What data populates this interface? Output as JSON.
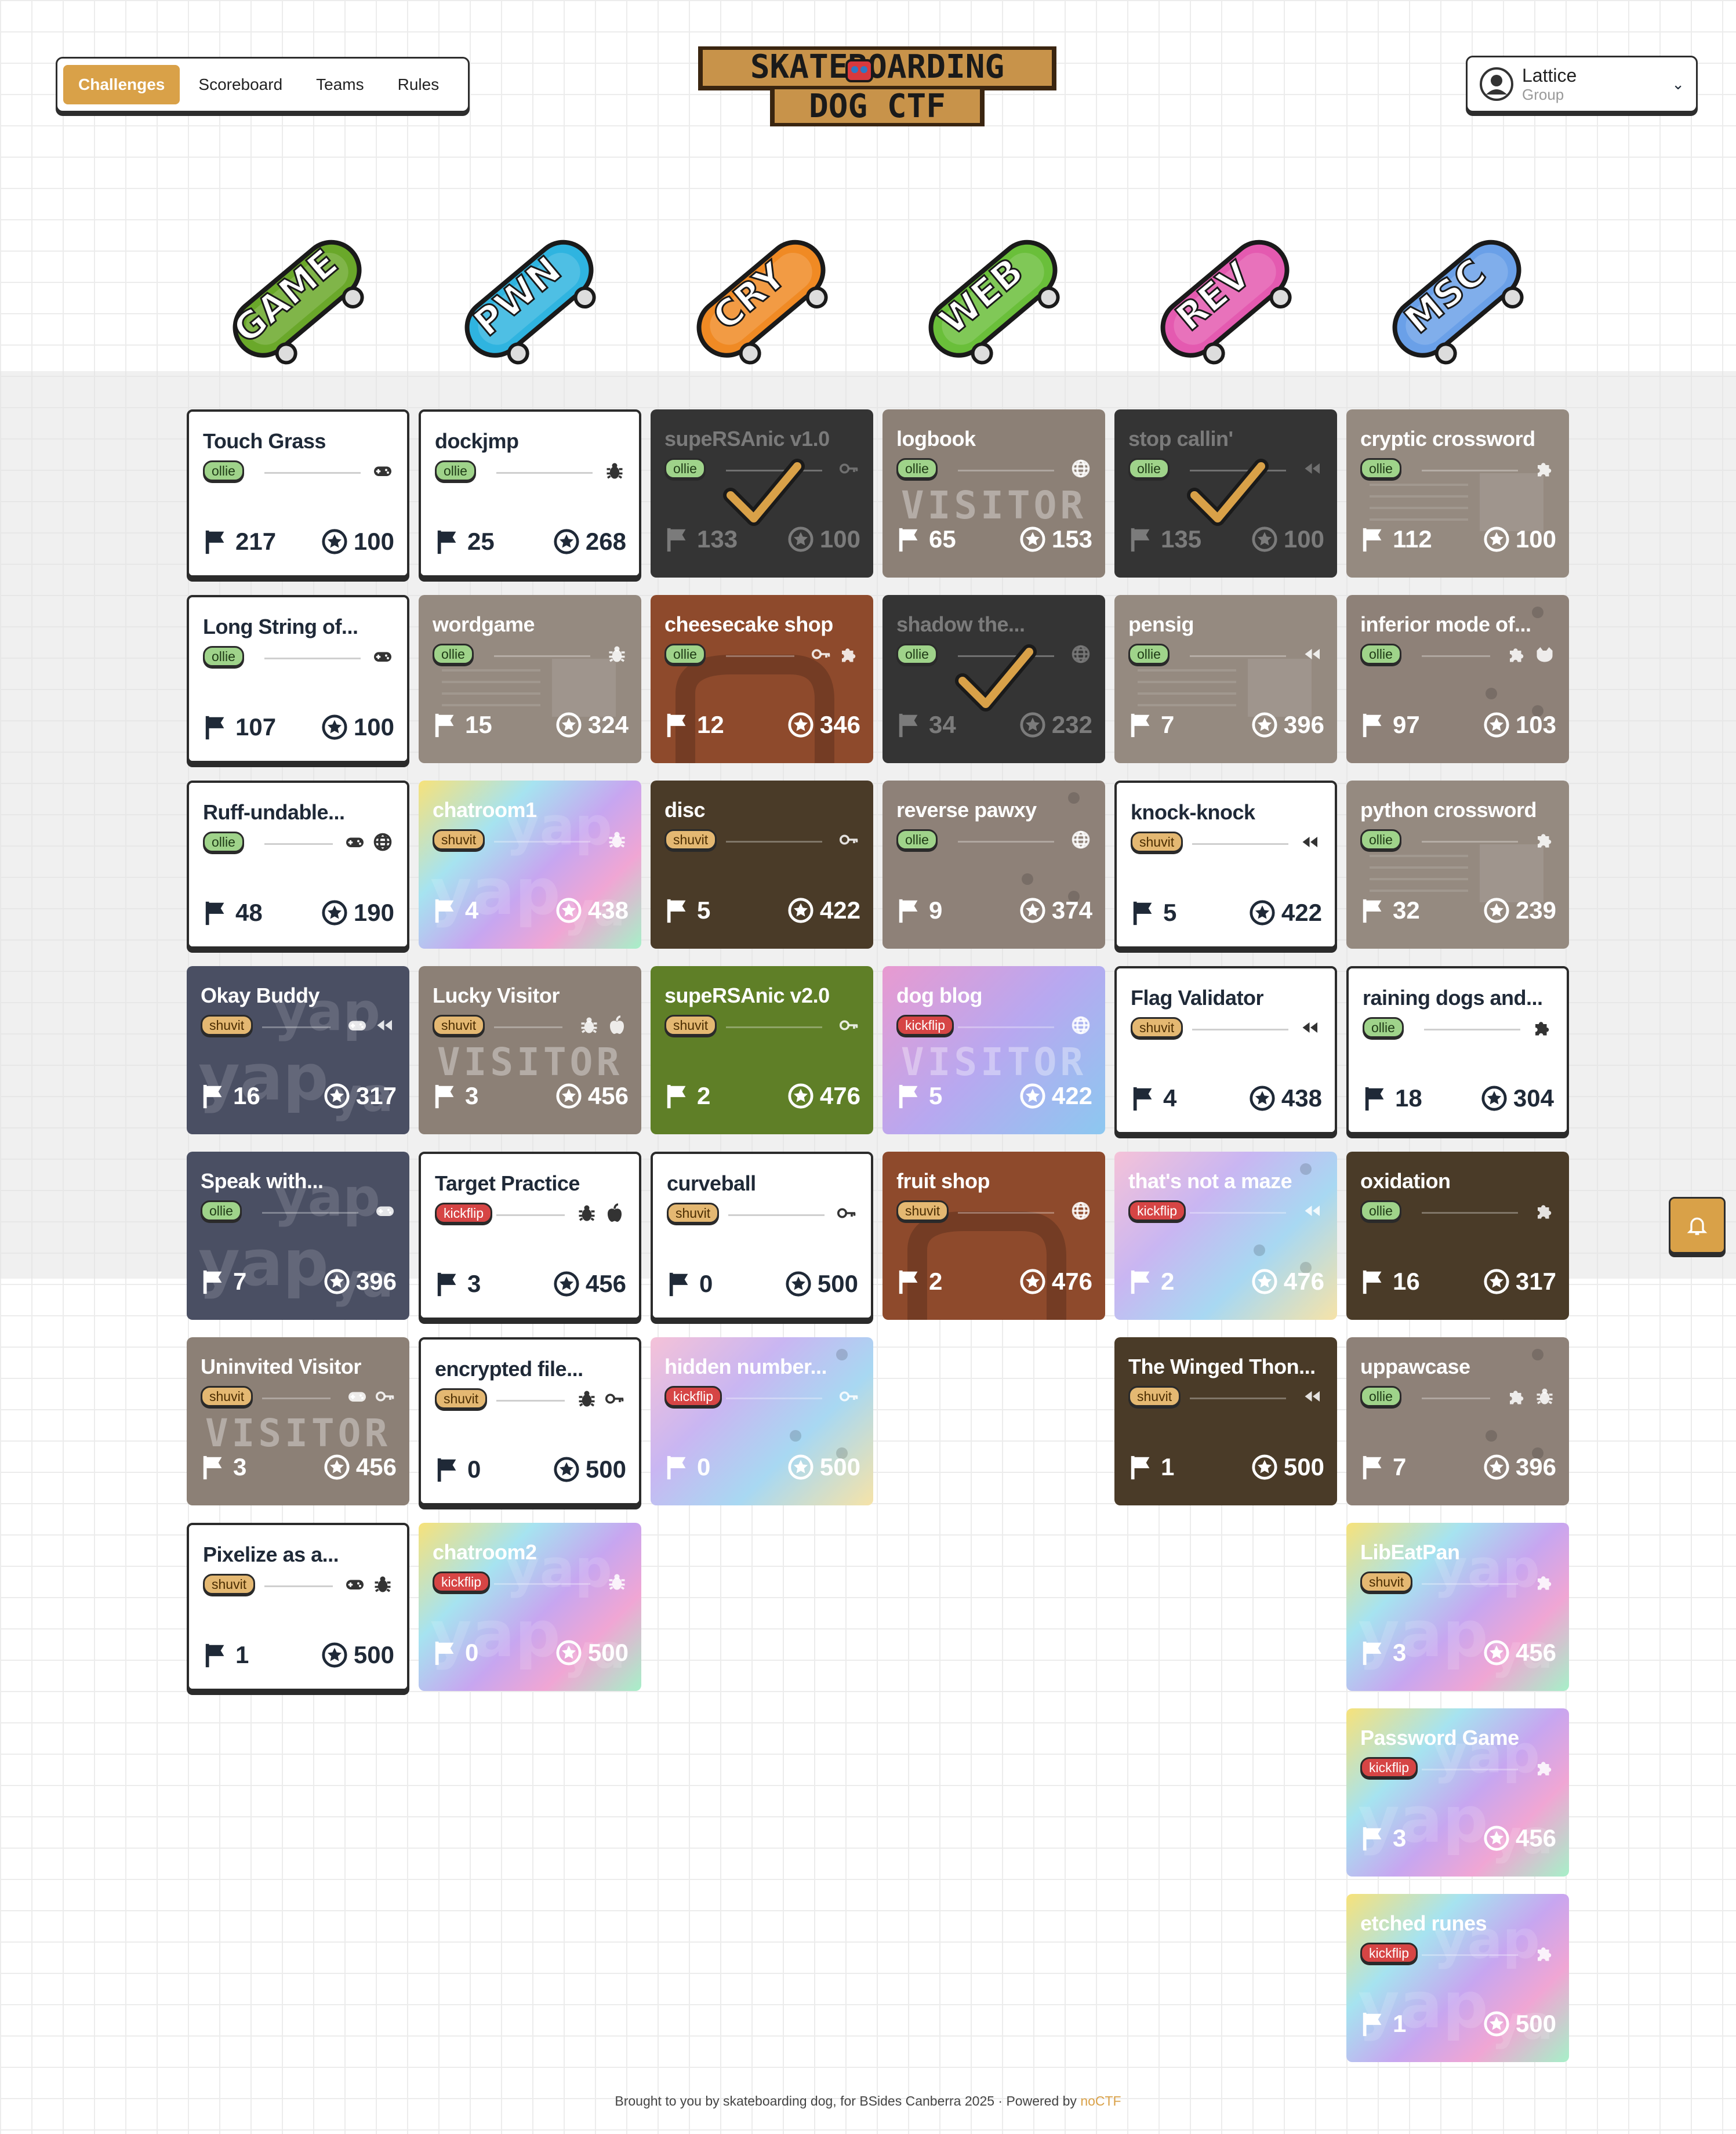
{
  "nav": {
    "tabs": [
      "Challenges",
      "Scoreboard",
      "Teams",
      "Rules"
    ],
    "active": "Challenges"
  },
  "logo": {
    "line1": "SKATEBOARDING",
    "line2": "DOG CTF"
  },
  "user": {
    "name": "Lattice",
    "group": "Group"
  },
  "categories": [
    {
      "label": "GAME",
      "color": "#6aa82a"
    },
    {
      "label": "PWN",
      "color": "#2fb4e0"
    },
    {
      "label": "CRY",
      "color": "#f08a24"
    },
    {
      "label": "WEB",
      "color": "#6abf3a"
    },
    {
      "label": "REV",
      "color": "#e45ab0"
    },
    {
      "label": "MSC",
      "color": "#6aa0e8"
    }
  ],
  "challenges": [
    {
      "col": 0,
      "row": 0,
      "title": "Touch Grass",
      "tag": "ollie",
      "icons": [
        "gamepad"
      ],
      "solves": "217",
      "points": "100",
      "theme": "plain"
    },
    {
      "col": 0,
      "row": 1,
      "title": "Long String of...",
      "tag": "ollie",
      "icons": [
        "gamepad"
      ],
      "solves": "107",
      "points": "100",
      "theme": "plain"
    },
    {
      "col": 0,
      "row": 2,
      "title": "Ruff-undable...",
      "tag": "ollie",
      "icons": [
        "gamepad",
        "globe"
      ],
      "solves": "48",
      "points": "190",
      "theme": "plain"
    },
    {
      "col": 0,
      "row": 3,
      "title": "Okay Buddy",
      "tag": "shuvit",
      "icons": [
        "gamepad",
        "rewind"
      ],
      "solves": "16",
      "points": "317",
      "theme": "navy"
    },
    {
      "col": 0,
      "row": 4,
      "title": "Speak with...",
      "tag": "ollie",
      "icons": [
        "gamepad"
      ],
      "solves": "7",
      "points": "396",
      "theme": "navy"
    },
    {
      "col": 0,
      "row": 5,
      "title": "Uninvited Visitor",
      "tag": "shuvit",
      "icons": [
        "gamepad",
        "key"
      ],
      "solves": "3",
      "points": "456",
      "theme": "visitor",
      "stamp": "VISITOR"
    },
    {
      "col": 0,
      "row": 6,
      "title": "Pixelize as a...",
      "tag": "shuvit",
      "icons": [
        "gamepad",
        "bug"
      ],
      "solves": "1",
      "points": "500",
      "theme": "plain"
    },
    {
      "col": 1,
      "row": 0,
      "title": "dockjmp",
      "tag": "ollie",
      "icons": [
        "bug"
      ],
      "solves": "25",
      "points": "268",
      "theme": "plain"
    },
    {
      "col": 1,
      "row": 1,
      "title": "wordgame",
      "tag": "ollie",
      "icons": [
        "bug"
      ],
      "solves": "15",
      "points": "324",
      "theme": "paper"
    },
    {
      "col": 1,
      "row": 2,
      "title": "chatroom1",
      "tag": "shuvit",
      "icons": [
        "bug"
      ],
      "solves": "4",
      "points": "438",
      "theme": "holo"
    },
    {
      "col": 1,
      "row": 3,
      "title": "Lucky Visitor",
      "tag": "shuvit",
      "icons": [
        "bug",
        "apple"
      ],
      "solves": "3",
      "points": "456",
      "theme": "visitor",
      "stamp": "VISITOR"
    },
    {
      "col": 1,
      "row": 4,
      "title": "Target Practice",
      "tag": "kickflip",
      "icons": [
        "bug",
        "apple"
      ],
      "solves": "3",
      "points": "456",
      "theme": "plain"
    },
    {
      "col": 1,
      "row": 5,
      "title": "encrypted file...",
      "tag": "shuvit",
      "icons": [
        "bug",
        "key"
      ],
      "solves": "0",
      "points": "500",
      "theme": "plain"
    },
    {
      "col": 1,
      "row": 6,
      "title": "chatroom2",
      "tag": "kickflip",
      "icons": [
        "bug"
      ],
      "solves": "0",
      "points": "500",
      "theme": "holo"
    },
    {
      "col": 2,
      "row": 0,
      "title": "supeRSAnic v1.0",
      "tag": "ollie",
      "icons": [
        "key"
      ],
      "solves": "133",
      "points": "100",
      "theme": "solved"
    },
    {
      "col": 2,
      "row": 1,
      "title": "cheesecake shop",
      "tag": "ollie",
      "icons": [
        "key",
        "puzzle"
      ],
      "solves": "12",
      "points": "346",
      "theme": "rust"
    },
    {
      "col": 2,
      "row": 2,
      "title": "disc",
      "tag": "shuvit",
      "icons": [
        "key"
      ],
      "solves": "5",
      "points": "422",
      "theme": "mud"
    },
    {
      "col": 2,
      "row": 3,
      "title": "supeRSAnic v2.0",
      "tag": "shuvit",
      "icons": [
        "key"
      ],
      "solves": "2",
      "points": "476",
      "theme": "green"
    },
    {
      "col": 2,
      "row": 4,
      "title": "curveball",
      "tag": "shuvit",
      "icons": [
        "key"
      ],
      "solves": "0",
      "points": "500",
      "theme": "plain"
    },
    {
      "col": 2,
      "row": 5,
      "title": "hidden number...",
      "tag": "kickflip",
      "icons": [
        "key"
      ],
      "solves": "0",
      "points": "500",
      "theme": "pastel"
    },
    {
      "col": 3,
      "row": 0,
      "title": "logbook",
      "tag": "ollie",
      "icons": [
        "globe"
      ],
      "solves": "65",
      "points": "153",
      "theme": "visitor",
      "stamp": "VISITOR"
    },
    {
      "col": 3,
      "row": 1,
      "title": "shadow the...",
      "tag": "ollie",
      "icons": [
        "globe"
      ],
      "solves": "34",
      "points": "232",
      "theme": "solved"
    },
    {
      "col": 3,
      "row": 2,
      "title": "reverse pawxy",
      "tag": "ollie",
      "icons": [
        "globe"
      ],
      "solves": "9",
      "points": "374",
      "theme": "taupe"
    },
    {
      "col": 3,
      "row": 3,
      "title": "dog blog",
      "tag": "kickflip",
      "icons": [
        "globe"
      ],
      "solves": "5",
      "points": "422",
      "theme": "gradient",
      "stamp": "VISITOR"
    },
    {
      "col": 3,
      "row": 4,
      "title": "fruit shop",
      "tag": "shuvit",
      "icons": [
        "globe"
      ],
      "solves": "2",
      "points": "476",
      "theme": "rust"
    },
    {
      "col": 4,
      "row": 0,
      "title": "stop callin'",
      "tag": "ollie",
      "icons": [
        "rewind"
      ],
      "solves": "135",
      "points": "100",
      "theme": "solved"
    },
    {
      "col": 4,
      "row": 1,
      "title": "pensig",
      "tag": "ollie",
      "icons": [
        "rewind"
      ],
      "solves": "7",
      "points": "396",
      "theme": "paper"
    },
    {
      "col": 4,
      "row": 2,
      "title": "knock-knock",
      "tag": "shuvit",
      "icons": [
        "rewind"
      ],
      "solves": "5",
      "points": "422",
      "theme": "plain"
    },
    {
      "col": 4,
      "row": 3,
      "title": "Flag Validator",
      "tag": "shuvit",
      "icons": [
        "rewind"
      ],
      "solves": "4",
      "points": "438",
      "theme": "plain"
    },
    {
      "col": 4,
      "row": 4,
      "title": "that's not a maze",
      "tag": "kickflip",
      "icons": [
        "rewind"
      ],
      "solves": "2",
      "points": "476",
      "theme": "pastel"
    },
    {
      "col": 4,
      "row": 5,
      "title": "The Winged Thon...",
      "tag": "shuvit",
      "icons": [
        "rewind"
      ],
      "solves": "1",
      "points": "500",
      "theme": "mud"
    },
    {
      "col": 5,
      "row": 0,
      "title": "cryptic crossword",
      "tag": "ollie",
      "icons": [
        "puzzle"
      ],
      "solves": "112",
      "points": "100",
      "theme": "paper"
    },
    {
      "col": 5,
      "row": 1,
      "title": "inferior mode of...",
      "tag": "ollie",
      "icons": [
        "puzzle",
        "dog"
      ],
      "solves": "97",
      "points": "103",
      "theme": "taupe"
    },
    {
      "col": 5,
      "row": 2,
      "title": "python crossword",
      "tag": "ollie",
      "icons": [
        "puzzle"
      ],
      "solves": "32",
      "points": "239",
      "theme": "paper"
    },
    {
      "col": 5,
      "row": 3,
      "title": "raining dogs and...",
      "tag": "ollie",
      "icons": [
        "puzzle"
      ],
      "solves": "18",
      "points": "304",
      "theme": "plain"
    },
    {
      "col": 5,
      "row": 4,
      "title": "oxidation",
      "tag": "ollie",
      "icons": [
        "puzzle"
      ],
      "solves": "16",
      "points": "317",
      "theme": "mud"
    },
    {
      "col": 5,
      "row": 5,
      "title": "uppawcase",
      "tag": "ollie",
      "icons": [
        "puzzle",
        "bug"
      ],
      "solves": "7",
      "points": "396",
      "theme": "taupe"
    },
    {
      "col": 5,
      "row": 6,
      "title": "LibEatPan",
      "tag": "shuvit",
      "icons": [
        "puzzle"
      ],
      "solves": "3",
      "points": "456",
      "theme": "holo"
    },
    {
      "col": 5,
      "row": 7,
      "title": "Password Game",
      "tag": "kickflip",
      "icons": [
        "puzzle"
      ],
      "solves": "3",
      "points": "456",
      "theme": "holo"
    },
    {
      "col": 5,
      "row": 8,
      "title": "etched runes",
      "tag": "kickflip",
      "icons": [
        "puzzle"
      ],
      "solves": "1",
      "points": "500",
      "theme": "holo"
    }
  ],
  "footer": {
    "text": "Brought to you by skateboarding dog, for BSides Canberra 2025 · Powered by ",
    "link": "noCTF"
  },
  "colors": {
    "accent": "#d9a148",
    "border": "#2d2d2d"
  }
}
